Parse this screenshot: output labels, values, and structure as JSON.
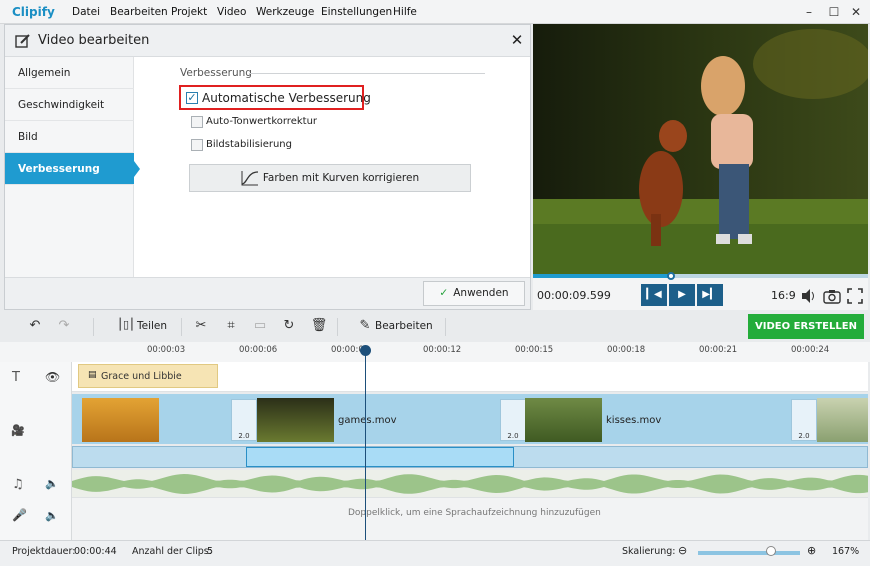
{
  "app": {
    "name": "Clipify",
    "menu": [
      "Datei",
      "Bearbeiten",
      "Projekt",
      "Video",
      "Werkzeuge",
      "Einstellungen",
      "Hilfe"
    ],
    "window_buttons": [
      "–",
      "☐",
      "✕"
    ]
  },
  "dialog": {
    "title": "Video bearbeiten",
    "sidebar": [
      "Allgemein",
      "Geschwindigkeit",
      "Bild",
      "Verbesserung"
    ],
    "active_item": "Verbesserung",
    "section": "Verbesserung",
    "options": [
      {
        "label": "Automatische Verbesserung",
        "checked": true
      },
      {
        "label": "Auto-Tonwertkorrektur",
        "checked": false
      },
      {
        "label": "Bildstabilisierung",
        "checked": false
      }
    ],
    "curves_button": "Farben mit Kurven korrigieren",
    "apply_button": "Anwenden"
  },
  "preview": {
    "time": "00:00:09.599",
    "aspect": "16:9",
    "progress": 0.41
  },
  "toolbar": {
    "split": "Teilen",
    "edit": "Bearbeiten",
    "create": "VIDEO ERSTELLEN"
  },
  "timeline": {
    "ticks": [
      "00:00:03",
      "00:00:06",
      "00:00:09",
      "00:00:12",
      "00:00:15",
      "00:00:18",
      "00:00:21",
      "00:00:24"
    ],
    "text_clip": "Grace und Libbie",
    "clips": [
      "games.mov",
      "kisses.mov"
    ],
    "transition_duration": "2.0",
    "voice_hint": "Doppelklick, um eine Sprachaufzeichnung hinzuzufügen"
  },
  "status": {
    "duration_label": "Projektdauer:",
    "duration": "00:00:44",
    "clips_label": "Anzahl der Clips:",
    "clips": "5",
    "zoom_label": "Skalierung:",
    "zoom": "167%"
  }
}
